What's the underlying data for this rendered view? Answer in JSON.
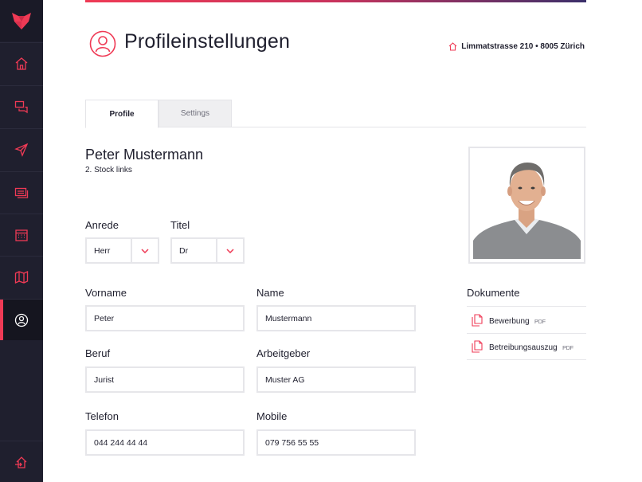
{
  "sidebar": {
    "logo_icon": "fox-logo-icon",
    "items": [
      {
        "icon": "home-icon",
        "active": false
      },
      {
        "icon": "chat-bubbles-icon",
        "active": false
      },
      {
        "icon": "paper-plane-icon",
        "active": false
      },
      {
        "icon": "cards-icon",
        "active": false
      },
      {
        "icon": "calendar-icon",
        "active": false
      },
      {
        "icon": "map-icon",
        "active": false
      },
      {
        "icon": "user-circle-icon",
        "active": true
      }
    ],
    "bottom_icon": "logout-icon"
  },
  "header": {
    "title": "Profileinstellungen",
    "address": "Limmatstrasse 210 • 8005 Zürich"
  },
  "tabs": [
    {
      "label": "Profile",
      "active": true
    },
    {
      "label": "Settings",
      "active": false
    }
  ],
  "person": {
    "name": "Peter Mustermann",
    "location": "2. Stock links"
  },
  "form": {
    "anrede": {
      "label": "Anrede",
      "value": "Herr"
    },
    "titel": {
      "label": "Titel",
      "value": "Dr"
    },
    "vorname": {
      "label": "Vorname",
      "value": "Peter"
    },
    "name": {
      "label": "Name",
      "value": "Mustermann"
    },
    "beruf": {
      "label": "Beruf",
      "value": "Jurist"
    },
    "arbeitgeber": {
      "label": "Arbeitgeber",
      "value": "Muster AG"
    },
    "telefon": {
      "label": "Telefon",
      "value": "044 244 44 44"
    },
    "mobile": {
      "label": "Mobile",
      "value": "079 756 55 55"
    }
  },
  "documents": {
    "title": "Dokumente",
    "items": [
      {
        "name": "Bewerbung",
        "type": "PDF"
      },
      {
        "name": "Betreibungsauszug",
        "type": "PDF"
      }
    ]
  },
  "colors": {
    "accent": "#ef3a55",
    "sidebar": "#1f1f2e",
    "border": "#e6e6ea"
  }
}
